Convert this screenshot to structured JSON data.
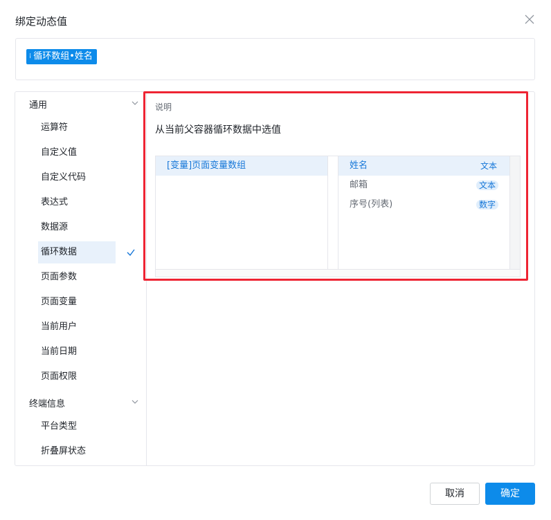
{
  "dialog": {
    "title": "绑定动态值",
    "close_icon": "close-icon"
  },
  "expression": {
    "tag_label": "循环数组•姓名",
    "tag_icon": "drag-grip-icon"
  },
  "sidebar": {
    "groups": [
      {
        "label": "通用",
        "items": [
          "运算符",
          "自定义值",
          "自定义代码",
          "表达式",
          "数据源",
          "循环数据",
          "页面参数",
          "页面变量",
          "当前用户",
          "当前日期",
          "页面权限"
        ]
      },
      {
        "label": "终端信息",
        "items": [
          "平台类型",
          "折叠屏状态"
        ]
      }
    ],
    "active_item": "循环数据"
  },
  "content": {
    "desc_label": "说明",
    "desc_text": "从当前父容器循环数据中选值",
    "sources": [
      "[变量]页面变量数组"
    ],
    "fields": [
      {
        "name": "姓名",
        "type": "文本"
      },
      {
        "name": "邮箱",
        "type": "文本"
      },
      {
        "name": "序号(列表)",
        "type": "数字"
      }
    ]
  },
  "footer": {
    "cancel_label": "取消",
    "ok_label": "确定"
  },
  "colors": {
    "accent": "#0d8bea",
    "highlight": "#ee2433",
    "selected_bg": "#e8f1fb"
  }
}
